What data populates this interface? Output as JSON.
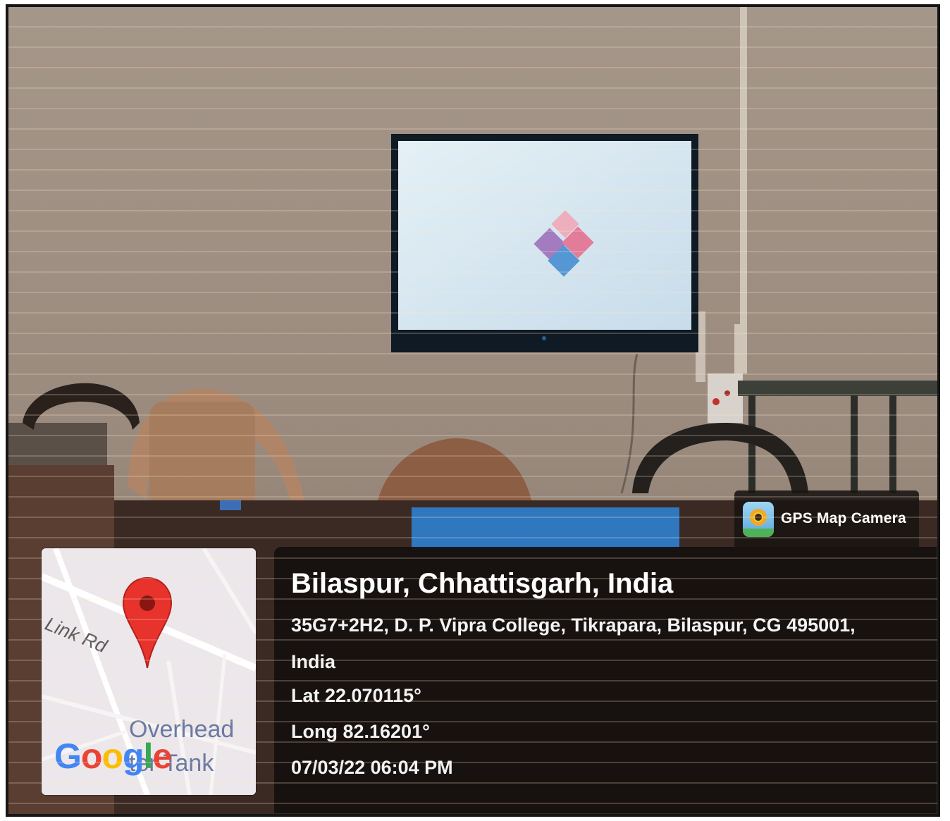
{
  "gps_badge": {
    "label": "GPS Map Camera",
    "icon": "camera-lens-icon"
  },
  "location": {
    "title": "Bilaspur, Chhattisgarh, India",
    "address_line_1": "35G7+2H2, D. P. Vipra College, Tikrapara, Bilaspur, CG 495001,",
    "address_line_2": "India",
    "latitude": "Lat 22.070115°",
    "longitude": "Long 82.16201°",
    "datetime": "07/03/22 06:04 PM"
  },
  "map": {
    "road_label": "Link Rd",
    "landmark_line_1": "Overhead",
    "landmark_line_2": "ter Tank",
    "logo": [
      "G",
      "o",
      "o",
      "g",
      "l",
      "e"
    ],
    "logo_colors": [
      "#4285F4",
      "#EA4335",
      "#FBBC05",
      "#4285F4",
      "#34A853",
      "#EA4335"
    ],
    "pin_color": "#e8322c"
  }
}
